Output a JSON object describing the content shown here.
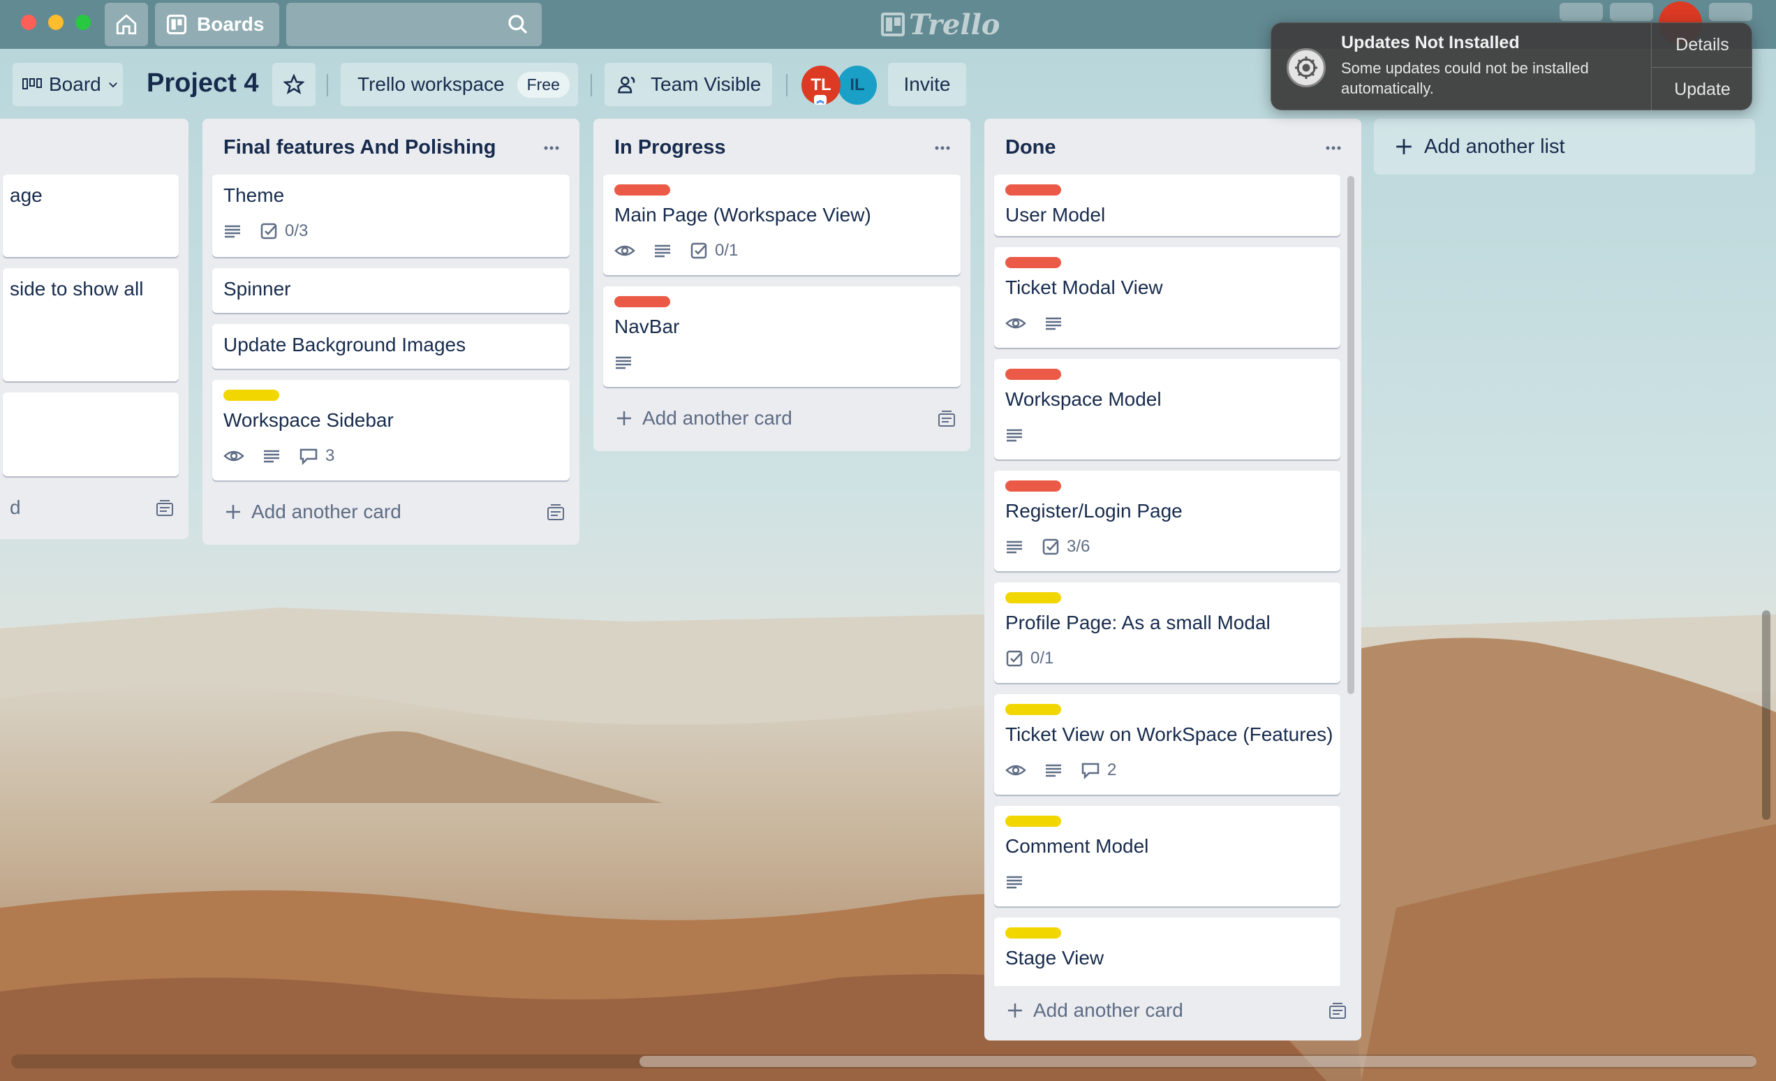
{
  "topbar": {
    "boards_label": "Boards",
    "logo_text": "Trello"
  },
  "header": {
    "view_label": "Board",
    "board_title": "Project 4",
    "workspace_label": "Trello workspace",
    "workspace_badge": "Free",
    "visibility_label": "Team Visible",
    "members": [
      {
        "initials": "TL",
        "color": "#dd3a24"
      },
      {
        "initials": "IL",
        "color": "#1a9fc6"
      }
    ],
    "invite_label": "Invite"
  },
  "lists": {
    "partial": {
      "cards": [
        {
          "text": "age"
        },
        {
          "text": "side to show all"
        },
        {
          "text": ""
        }
      ],
      "add_text": "d"
    },
    "final": {
      "title": "Final features And Polishing",
      "cards": [
        {
          "title": "Theme",
          "checklist": "0/3"
        },
        {
          "title": "Spinner"
        },
        {
          "title": "Update Background Images"
        },
        {
          "title": "Workspace Sidebar",
          "comments": "3"
        }
      ],
      "add_label": "Add another card"
    },
    "in_progress": {
      "title": "In Progress",
      "cards": [
        {
          "title": "Main Page (Workspace View)",
          "checklist": "0/1"
        },
        {
          "title": "NavBar"
        }
      ],
      "add_label": "Add another card"
    },
    "done": {
      "title": "Done",
      "cards": [
        {
          "title": "User Model"
        },
        {
          "title": "Ticket Modal View"
        },
        {
          "title": "Workspace Model"
        },
        {
          "title": "Register/Login Page",
          "checklist": "3/6"
        },
        {
          "title": "Profile Page: As a small Modal",
          "checklist": "0/1"
        },
        {
          "title": "Ticket View on WorkSpace (Features)",
          "comments": "2"
        },
        {
          "title": "Comment Model"
        },
        {
          "title": "Stage View"
        }
      ],
      "add_label": "Add another card"
    }
  },
  "add_list_label": "Add another list",
  "notification": {
    "title": "Updates Not Installed",
    "body": "Some updates could not be installed automatically.",
    "details_label": "Details",
    "update_label": "Update"
  },
  "colors": {
    "label_red": "#eb5a46",
    "label_yellow": "#f2d600",
    "list_bg": "#ebecf0",
    "text": "#172b4d"
  }
}
